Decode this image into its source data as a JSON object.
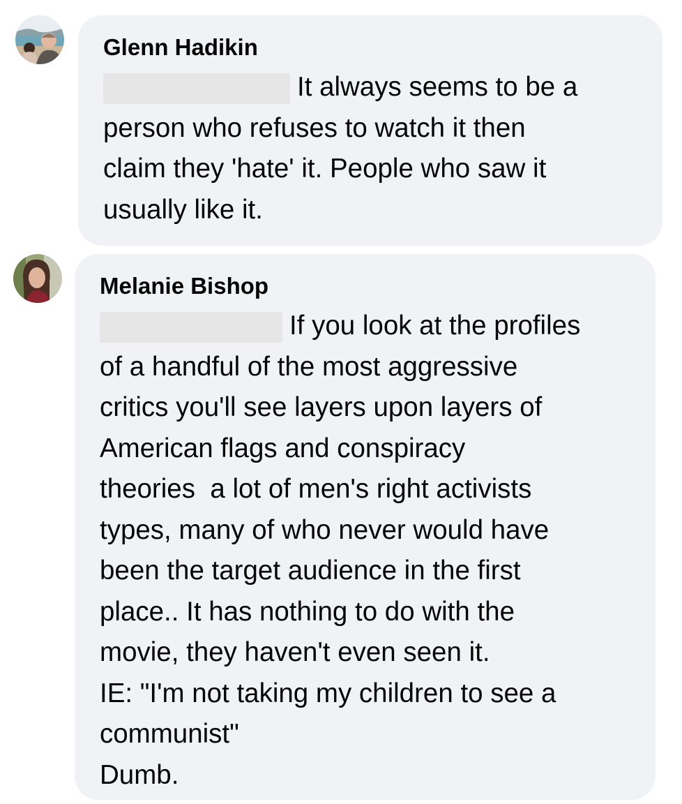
{
  "comments": [
    {
      "author": "Glenn Hadikin",
      "avatar_icon": "profile-photo-beach",
      "mention_redacted": true,
      "lines": [
        "It always seems to be a",
        "person who refuses to watch it then",
        "claim they 'hate' it. People who saw it",
        "usually like it."
      ]
    },
    {
      "author": "Melanie Bishop",
      "avatar_icon": "profile-photo-woman",
      "mention_redacted": true,
      "lines": [
        "If you look at the profiles",
        "of a handful of the most aggressive",
        "critics you'll see layers upon layers of",
        "American flags and conspiracy",
        "theories  a lot of men's right activists",
        "types, many of who never would have",
        "been the target audience in the first",
        "place.. It has nothing to do with the",
        "movie, they haven't even seen it.",
        "IE: \"I'm not taking my children to see a",
        "communist\"",
        "Dumb."
      ]
    }
  ],
  "colors": {
    "bubble_background": "#f0f2f5",
    "text": "#050505",
    "redaction": "#e6e6e6"
  }
}
